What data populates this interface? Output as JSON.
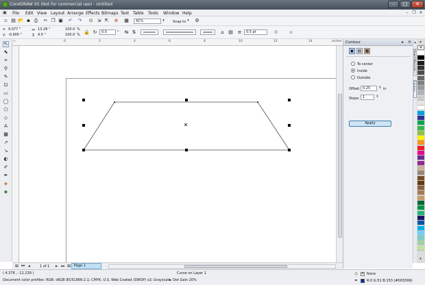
{
  "window": {
    "title": "CorelDRAW X5 (Not for commercial use) - Untitled",
    "minimize_label": "–",
    "maximize_label": "□",
    "close_label": "✕"
  },
  "menu": {
    "items": [
      "File",
      "Edit",
      "View",
      "Layout",
      "Arrange",
      "Effects",
      "Bitmaps",
      "Text",
      "Table",
      "Tools",
      "Window",
      "Help"
    ]
  },
  "standard_toolbar": {
    "zoom_value": "41%",
    "snap_to_label": "Snap to"
  },
  "property_bar": {
    "x_label": "x:",
    "x_value": "9.077 \"",
    "y_label": "y:",
    "y_value": "-0.905 \"",
    "width_value": "13.28 \"",
    "height_value": "4.5 \"",
    "scale_x": "100.0",
    "scale_y": "100.0",
    "pct": "%",
    "angle_value": "0.0",
    "angle_unit": "°",
    "outline_width": "0.5 pt"
  },
  "ruler": {
    "top_ticks": [
      "0",
      "2",
      "4",
      "6",
      "8",
      "10",
      "12",
      "14"
    ],
    "unit": "inches"
  },
  "docker": {
    "title": "Contour",
    "options": [
      {
        "label": "To center",
        "selected": false
      },
      {
        "label": "Inside",
        "selected": true
      },
      {
        "label": "Outside",
        "selected": false
      }
    ],
    "offset_label": "Offset:",
    "offset_value": "0.25",
    "offset_unit": "in",
    "steps_label": "Steps:",
    "steps_value": "1",
    "apply_label": "Apply"
  },
  "side_tabs": [
    "Object Manager",
    "Contour"
  ],
  "page_nav": {
    "counter": "1 of 1",
    "page_tab": "Page 1"
  },
  "status": {
    "coords": "( 4.376 , -11.239 )",
    "layer_info": "Curve on Layer 1",
    "doc_profiles": "Document color profiles: RGB: sRGB IEC61966-2.1; CMYK: U.S. Web Coated (SWOP) v2; Grayscale: Dot Gain 20%",
    "fill_label": "None",
    "outline_color_label": "R:0 G:51 B:153 (#003399)"
  },
  "colors": {
    "outline_swatch": "#003399",
    "apply_button": "#cfe4f6",
    "palette": [
      "#ffffff",
      "#000000",
      "#1a1a1a",
      "#333333",
      "#4d4d4d",
      "#666666",
      "#808080",
      "#999999",
      "#b3b3b3",
      "#cccccc",
      "#e6e6e6",
      "#ffffff",
      "#00a0e0",
      "#2e3192",
      "#00a651",
      "#39b54a",
      "#8dc63f",
      "#fff200",
      "#f7941d",
      "#ed1c24",
      "#ec008c",
      "#662d91",
      "#92278f",
      "#c7b299",
      "#998675",
      "#754c24",
      "#603913",
      "#8c6239",
      "#a67c52",
      "#c69c6d",
      "#006837",
      "#009245",
      "#22b573",
      "#1b1464",
      "#0054a6",
      "#00aeef",
      "#6dcff6",
      "#7accc8",
      "#a0d3a2",
      "#c4df9b"
    ]
  }
}
